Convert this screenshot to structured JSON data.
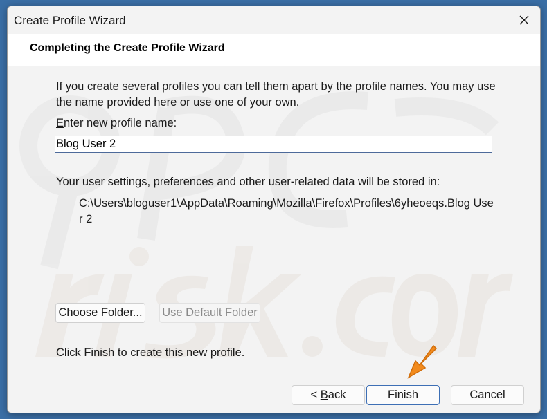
{
  "window": {
    "title": "Create Profile Wizard"
  },
  "header": {
    "title": "Completing the Create Profile Wizard"
  },
  "intro": {
    "text": "If you create several profiles you can tell them apart by the profile names. You may use the name provided here or use one of your own."
  },
  "profile_name": {
    "label_accel": "E",
    "label_rest": "nter new profile name:",
    "value": "Blog User 2"
  },
  "storage": {
    "label": "Your user settings, preferences and other user-related data will be stored in:",
    "path": "C:\\Users\\bloguser1\\AppData\\Roaming\\Mozilla\\Firefox\\Profiles\\6yheoeqs.Blog User 2"
  },
  "buttons": {
    "choose_folder_accel": "C",
    "choose_folder_rest": "hoose Folder...",
    "use_default_accel": "U",
    "use_default_rest": "se Default Folder",
    "back_prefix": "< ",
    "back_accel": "B",
    "back_rest": "ack",
    "finish": "Finish",
    "cancel": "Cancel"
  },
  "footer": {
    "finish_hint": "Click Finish to create this new profile."
  },
  "colors": {
    "accent_arrow": "#f28a1c",
    "primary_border": "#3d6fb5"
  },
  "icons": {
    "close": "close-icon",
    "pointer": "arrow-pointer-icon"
  }
}
